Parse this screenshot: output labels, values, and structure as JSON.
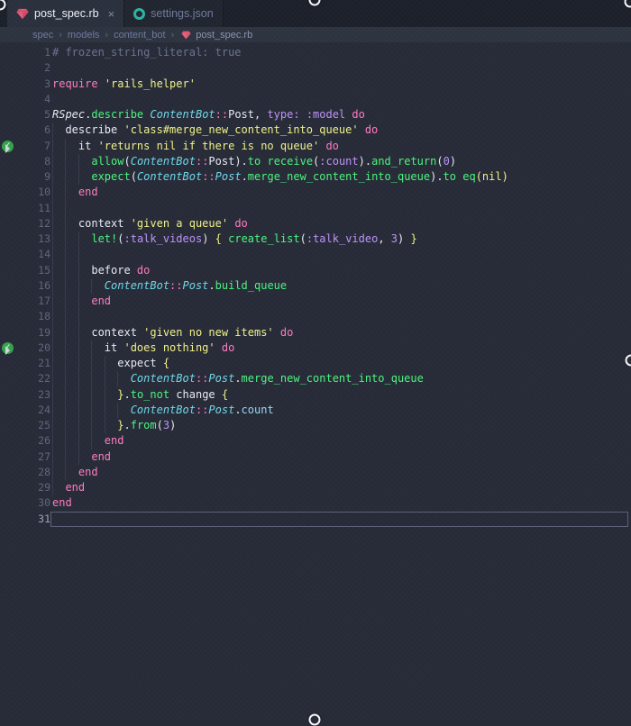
{
  "tabs": [
    {
      "label": "post_spec.rb",
      "icon": "ruby-gem",
      "active": true,
      "close": "×"
    },
    {
      "label": "settings.json",
      "icon": "json-ring",
      "active": false
    }
  ],
  "breadcrumb": {
    "segments": [
      "spec",
      "models",
      "content_bot"
    ],
    "separator": "›",
    "file": "post_spec.rb"
  },
  "colors": {
    "editor_bg": "#272b37",
    "tabbar_bg": "#1c202a",
    "active_tab_bg": "#2b303d",
    "breadcrumb_bg": "#2e3340",
    "keyword_pink": "#ff7ac2",
    "string_yellow": "#eff188",
    "function_green": "#4af57e",
    "class_cyan": "#6ed7ea",
    "symbol_purple": "#bd93f9",
    "comment_gray": "#6a7291",
    "ruby_icon_red": "#e0566f",
    "json_icon_teal": "#2db3a2",
    "test_pass_green": "#35a24c"
  },
  "editor": {
    "current_line": 31,
    "passed_lines": [
      7,
      20
    ],
    "lines": [
      {
        "n": 1,
        "g": 0,
        "t": [
          [
            "cm",
            "# frozen_string_literal: true"
          ]
        ]
      },
      {
        "n": 2,
        "g": 0,
        "t": []
      },
      {
        "n": 3,
        "g": 0,
        "t": [
          [
            "kw",
            "require"
          ],
          [
            "tx",
            " "
          ],
          [
            "st",
            "'rails_helper'"
          ]
        ]
      },
      {
        "n": 4,
        "g": 0,
        "t": []
      },
      {
        "n": 5,
        "g": 0,
        "t": [
          [
            "itw",
            "RSpec"
          ],
          [
            "tx",
            "."
          ],
          [
            "fn",
            "describe"
          ],
          [
            "tx",
            " "
          ],
          [
            "cl",
            "ContentBot"
          ],
          [
            "kw",
            "::"
          ],
          [
            "tx",
            "Post"
          ],
          [
            "tx",
            ", "
          ],
          [
            "pu",
            "type:"
          ],
          [
            "tx",
            " "
          ],
          [
            "pu",
            ":model"
          ],
          [
            "tx",
            " "
          ],
          [
            "kw",
            "do"
          ]
        ]
      },
      {
        "n": 6,
        "g": 1,
        "t": [
          [
            "tx",
            "  describe "
          ],
          [
            "st",
            "'class#merge_new_content_into_queue'"
          ],
          [
            "tx",
            " "
          ],
          [
            "kw",
            "do"
          ]
        ]
      },
      {
        "n": 7,
        "g": 2,
        "t": [
          [
            "tx",
            "    it "
          ],
          [
            "st",
            "'returns nil if there is no queue'"
          ],
          [
            "tx",
            " "
          ],
          [
            "kw",
            "do"
          ]
        ]
      },
      {
        "n": 8,
        "g": 3,
        "t": [
          [
            "tx",
            "      "
          ],
          [
            "fn",
            "allow"
          ],
          [
            "tx",
            "("
          ],
          [
            "cl",
            "ContentBot"
          ],
          [
            "kw",
            "::"
          ],
          [
            "tx",
            "Post"
          ],
          [
            "tx",
            ")."
          ],
          [
            "fn",
            "to"
          ],
          [
            "tx",
            " "
          ],
          [
            "fn",
            "receive"
          ],
          [
            "tx",
            "("
          ],
          [
            "pu",
            ":count"
          ],
          [
            "tx",
            ")."
          ],
          [
            "fn",
            "and_return"
          ],
          [
            "tx",
            "("
          ],
          [
            "pu",
            "0"
          ],
          [
            "tx",
            ")"
          ]
        ]
      },
      {
        "n": 9,
        "g": 3,
        "t": [
          [
            "tx",
            "      "
          ],
          [
            "fn",
            "expect"
          ],
          [
            "tx",
            "("
          ],
          [
            "cl",
            "ContentBot"
          ],
          [
            "kw",
            "::"
          ],
          [
            "cl",
            "Post"
          ],
          [
            "tx",
            "."
          ],
          [
            "fn",
            "merge_new_content_into_queue"
          ],
          [
            "tx",
            ")."
          ],
          [
            "fn",
            "to"
          ],
          [
            "tx",
            " "
          ],
          [
            "fn",
            "eq"
          ],
          [
            "st",
            "(nil)"
          ]
        ]
      },
      {
        "n": 10,
        "g": 2,
        "t": [
          [
            "tx",
            "    "
          ],
          [
            "kw",
            "end"
          ]
        ]
      },
      {
        "n": 11,
        "g": 2,
        "t": []
      },
      {
        "n": 12,
        "g": 2,
        "t": [
          [
            "tx",
            "    context "
          ],
          [
            "st",
            "'given a queue'"
          ],
          [
            "tx",
            " "
          ],
          [
            "kw",
            "do"
          ]
        ]
      },
      {
        "n": 13,
        "g": 3,
        "t": [
          [
            "tx",
            "      "
          ],
          [
            "fn",
            "let!"
          ],
          [
            "tx",
            "("
          ],
          [
            "pu",
            ":talk_videos"
          ],
          [
            "tx",
            ") "
          ],
          [
            "st",
            "{"
          ],
          [
            "tx",
            " "
          ],
          [
            "fn",
            "create_list"
          ],
          [
            "tx",
            "("
          ],
          [
            "pu",
            ":talk_video"
          ],
          [
            "tx",
            ", "
          ],
          [
            "pu",
            "3"
          ],
          [
            "tx",
            ") "
          ],
          [
            "st",
            "}"
          ]
        ]
      },
      {
        "n": 14,
        "g": 3,
        "t": []
      },
      {
        "n": 15,
        "g": 3,
        "t": [
          [
            "tx",
            "      before "
          ],
          [
            "kw",
            "do"
          ]
        ]
      },
      {
        "n": 16,
        "g": 4,
        "t": [
          [
            "tx",
            "        "
          ],
          [
            "cl",
            "ContentBot"
          ],
          [
            "kw",
            "::"
          ],
          [
            "cl",
            "Post"
          ],
          [
            "tx",
            "."
          ],
          [
            "fn",
            "build_queue"
          ]
        ]
      },
      {
        "n": 17,
        "g": 3,
        "t": [
          [
            "tx",
            "      "
          ],
          [
            "kw",
            "end"
          ]
        ]
      },
      {
        "n": 18,
        "g": 3,
        "t": []
      },
      {
        "n": 19,
        "g": 3,
        "t": [
          [
            "tx",
            "      context "
          ],
          [
            "st",
            "'given no new items'"
          ],
          [
            "tx",
            " "
          ],
          [
            "kw",
            "do"
          ]
        ]
      },
      {
        "n": 20,
        "g": 4,
        "t": [
          [
            "tx",
            "        it "
          ],
          [
            "st",
            "'does nothing'"
          ],
          [
            "tx",
            " "
          ],
          [
            "kw",
            "do"
          ]
        ]
      },
      {
        "n": 21,
        "g": 5,
        "t": [
          [
            "tx",
            "          expect "
          ],
          [
            "st",
            "{"
          ]
        ]
      },
      {
        "n": 22,
        "g": 6,
        "t": [
          [
            "tx",
            "            "
          ],
          [
            "cl",
            "ContentBot"
          ],
          [
            "kw",
            "::"
          ],
          [
            "cl",
            "Post"
          ],
          [
            "tx",
            "."
          ],
          [
            "fn",
            "merge_new_content_into_queue"
          ]
        ]
      },
      {
        "n": 23,
        "g": 5,
        "t": [
          [
            "tx",
            "          "
          ],
          [
            "st",
            "}"
          ],
          [
            "tx",
            "."
          ],
          [
            "fn",
            "to_not"
          ],
          [
            "tx",
            " change "
          ],
          [
            "st",
            "{"
          ]
        ]
      },
      {
        "n": 24,
        "g": 6,
        "t": [
          [
            "tx",
            "            "
          ],
          [
            "cl",
            "ContentBot"
          ],
          [
            "kw",
            "::"
          ],
          [
            "cl",
            "Post"
          ],
          [
            "tx",
            "."
          ],
          [
            "bl",
            "count"
          ]
        ]
      },
      {
        "n": 25,
        "g": 5,
        "t": [
          [
            "tx",
            "          "
          ],
          [
            "st",
            "}"
          ],
          [
            "tx",
            "."
          ],
          [
            "fn",
            "from"
          ],
          [
            "tx",
            "("
          ],
          [
            "pu",
            "3"
          ],
          [
            "tx",
            ")"
          ]
        ]
      },
      {
        "n": 26,
        "g": 4,
        "t": [
          [
            "tx",
            "        "
          ],
          [
            "kw",
            "end"
          ]
        ]
      },
      {
        "n": 27,
        "g": 3,
        "t": [
          [
            "tx",
            "      "
          ],
          [
            "kw",
            "end"
          ]
        ]
      },
      {
        "n": 28,
        "g": 2,
        "t": [
          [
            "tx",
            "    "
          ],
          [
            "kw",
            "end"
          ]
        ]
      },
      {
        "n": 29,
        "g": 1,
        "t": [
          [
            "tx",
            "  "
          ],
          [
            "kw",
            "end"
          ]
        ]
      },
      {
        "n": 30,
        "g": 0,
        "t": [
          [
            "kw",
            "end"
          ]
        ]
      },
      {
        "n": 31,
        "g": 0,
        "t": []
      }
    ]
  }
}
